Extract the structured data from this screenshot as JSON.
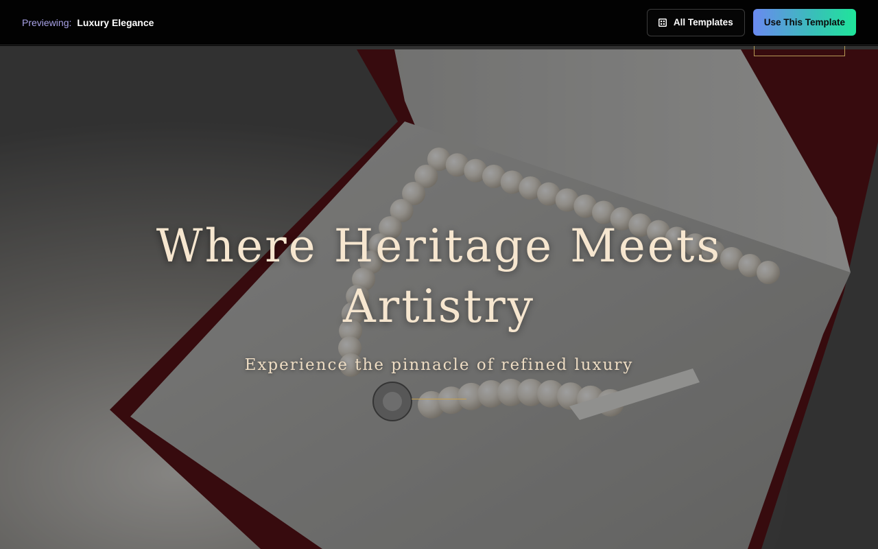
{
  "preview_bar": {
    "label": "Previewing:",
    "template_name": "Luxury Elegance",
    "all_templates_label": "All Templates",
    "all_templates_icon": "grid-icon",
    "use_template_label": "Use This Template"
  },
  "hero": {
    "title": "Where Heritage Meets Artistry",
    "subtitle": "Experience the pinnacle of refined luxury",
    "background_image": "pearl-necklace-in-red-gift-box"
  },
  "colors": {
    "title": "#f6e6cf",
    "accent_gold": "#c9a24f",
    "preview_label": "#a9a3e8",
    "gradient_start": "#6a89f0",
    "gradient_end": "#1fe59a"
  }
}
